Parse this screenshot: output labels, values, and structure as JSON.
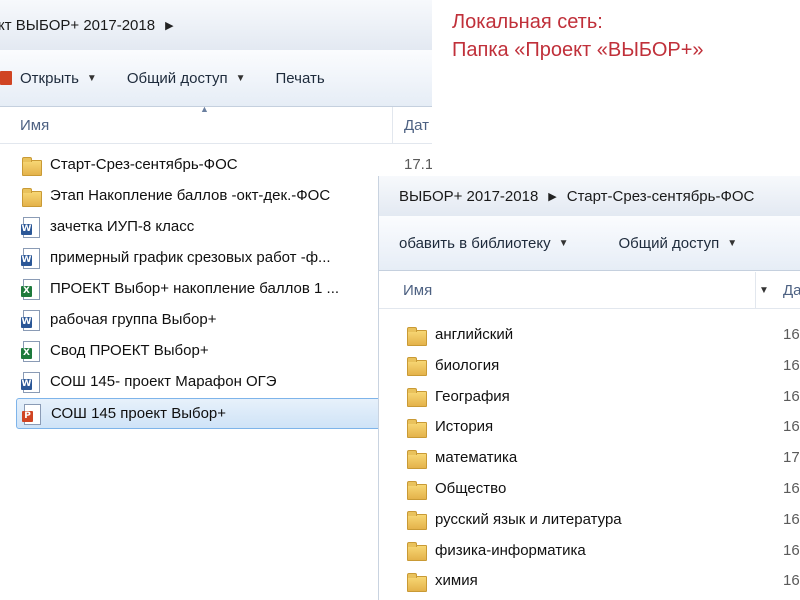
{
  "caption": {
    "line1": "Локальная сеть:",
    "line2": "Папка «Проект «ВЫБОР+»"
  },
  "window1": {
    "breadcrumb": [
      "кт ВЫБОР+ 2017-2018"
    ],
    "toolbar": {
      "open_label": "Открыть",
      "share_label": "Общий доступ",
      "print_label": "Печать"
    },
    "columns": {
      "name": "Имя",
      "date": "Дат"
    },
    "files": [
      {
        "name": "Старт-Срез-сентябрь-ФОС",
        "icon": "folder-icon",
        "date": "17.1"
      },
      {
        "name": "Этап Накопление баллов -окт-дек.-ФОС",
        "icon": "folder-icon",
        "date": ""
      },
      {
        "name": "зачетка ИУП-8 класс",
        "icon": "word-icon",
        "date": ""
      },
      {
        "name": "примерный график срезовых работ -ф...",
        "icon": "word-icon",
        "date": ""
      },
      {
        "name": "ПРОЕКТ Выбор+ накопление баллов 1 ...",
        "icon": "excel-icon",
        "date": ""
      },
      {
        "name": "рабочая группа Выбор+",
        "icon": "word-icon",
        "date": ""
      },
      {
        "name": "Свод ПРОЕКТ Выбор+",
        "icon": "excel-icon",
        "date": ""
      },
      {
        "name": "СОШ 145- проект Марафон ОГЭ",
        "icon": "word-icon",
        "date": ""
      },
      {
        "name": "СОШ 145 проект Выбор+",
        "icon": "ppt-icon",
        "date": ""
      }
    ]
  },
  "window2": {
    "breadcrumb": [
      "ВЫБОР+ 2017-2018",
      "Старт-Срез-сентябрь-ФОС"
    ],
    "toolbar": {
      "library_label": "обавить в библиотеку",
      "share_label": "Общий доступ"
    },
    "columns": {
      "name": "Имя",
      "date": "Да"
    },
    "folders": [
      {
        "name": "английский",
        "date": "16"
      },
      {
        "name": "биология",
        "date": "16"
      },
      {
        "name": "География",
        "date": "16"
      },
      {
        "name": "История",
        "date": "16"
      },
      {
        "name": "математика",
        "date": "17"
      },
      {
        "name": "Общество",
        "date": "16"
      },
      {
        "name": "русский язык и литература",
        "date": "16"
      },
      {
        "name": "физика-информатика",
        "date": "16"
      },
      {
        "name": "химия",
        "date": "16"
      }
    ]
  }
}
